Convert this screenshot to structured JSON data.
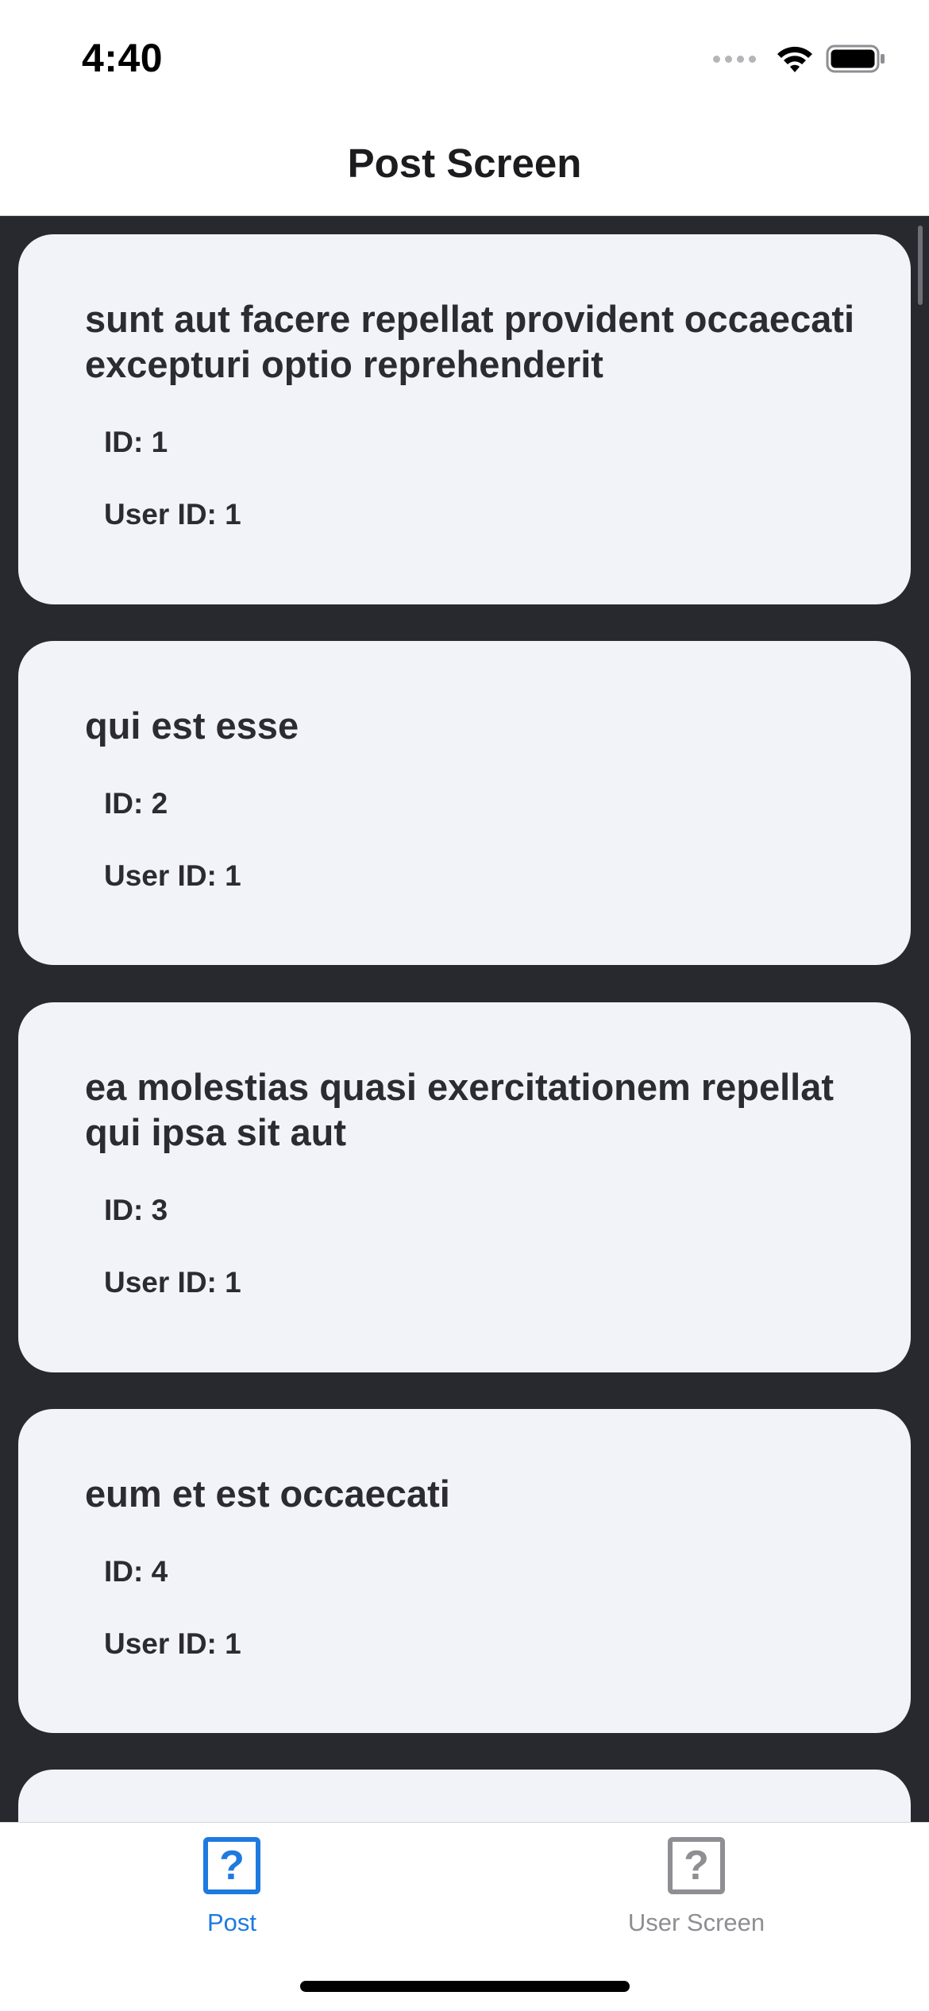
{
  "status_bar": {
    "time": "4:40",
    "icons": [
      "signal-dots-icon",
      "wifi-icon",
      "battery-icon"
    ]
  },
  "header": {
    "title": "Post Screen"
  },
  "posts": [
    {
      "title": "sunt aut facere repellat provident occaecati excepturi optio reprehenderit",
      "id": "ID: 1",
      "user_id": "User ID: 1"
    },
    {
      "title": "qui est esse",
      "id": "ID: 2",
      "user_id": "User ID: 1"
    },
    {
      "title": "ea molestias quasi exercitationem repellat qui ipsa sit aut",
      "id": "ID: 3",
      "user_id": "User ID: 1"
    },
    {
      "title": "eum et est occaecati",
      "id": "ID: 4",
      "user_id": "User ID: 1"
    }
  ],
  "tab_bar": {
    "tabs": [
      {
        "label": "Post",
        "icon": "?",
        "active": true
      },
      {
        "label": "User Screen",
        "icon": "?",
        "active": false
      }
    ]
  },
  "colors": {
    "accent": "#1e7ae0",
    "inactive": "#8e8e93",
    "list_background": "#28282f",
    "card_background": "#f2f3f8"
  }
}
